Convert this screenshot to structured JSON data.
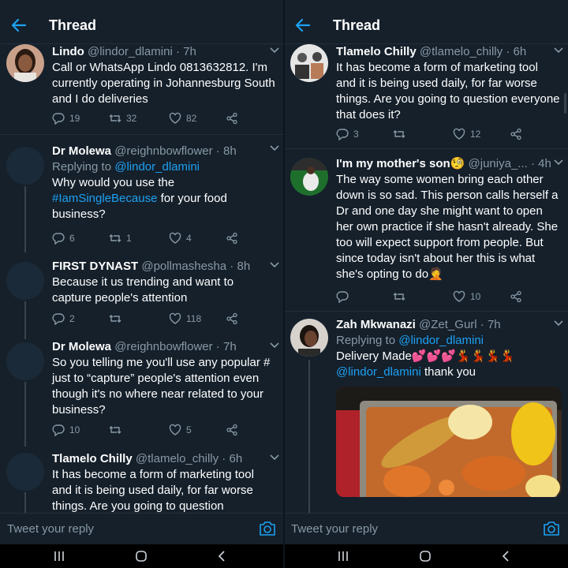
{
  "left": {
    "header": {
      "title": "Thread"
    },
    "tweets": [
      {
        "name": "Lindo",
        "handle": "@lindor_dlamini",
        "time": "7h",
        "text": "Call or WhatsApp Lindo 0813632812. I'm currently operating in Johannesburg South and I do deliveries",
        "replies": "19",
        "retweets": "32",
        "likes": "82"
      },
      {
        "name": "Dr Molewa",
        "handle": "@reighnbowflower",
        "time": "8h",
        "replying_prefix": "Replying to",
        "replying_to": "@lindor_dlamini",
        "text_before": "Why would you use the",
        "hashtag": "#IamSingleBecause",
        "text_after": "for your food business?",
        "replies": "6",
        "retweets": "1",
        "likes": "4"
      },
      {
        "name": "FIRST DYNAST",
        "handle": "@pollmashesha",
        "time": "8h",
        "text": "Because it us trending and want to capture people's attention",
        "replies": "2",
        "retweets": "",
        "likes": "118"
      },
      {
        "name": "Dr Molewa",
        "handle": "@reighnbowflower",
        "time": "7h",
        "text": "So you telling me you'll use any popular # just to “capture” people's attention even though it's no where near related to your business?",
        "replies": "10",
        "retweets": "",
        "likes": "5"
      },
      {
        "name": "Tlamelo Chilly",
        "handle": "@tlamelo_chilly",
        "time": "6h",
        "text": "It has become a form of marketing tool and it is being used daily, for far worse things. Are you going to question"
      }
    ],
    "reply_placeholder": "Tweet your reply"
  },
  "right": {
    "header": {
      "title": "Thread"
    },
    "tweets": [
      {
        "name": "Tlamelo Chilly",
        "handle": "@tlamelo_chilly",
        "time": "6h",
        "text": "It has become a form of marketing tool and it is being used daily, for far worse things. Are you going to question everyone that does it?",
        "replies": "3",
        "retweets": "",
        "likes": "12"
      },
      {
        "name": "I'm my mother's son🧐",
        "handle": "@juniya_...",
        "time": "4h",
        "text": "The way some women bring each other down is so sad. This person calls herself a Dr and one day she might want to open her own practice if she hasn't already. She too will expect support from people. But since today isn't about her this is what she's opting to do🤦",
        "replies": "",
        "retweets": "",
        "likes": "10"
      },
      {
        "name": "Zah Mkwanazi",
        "handle": "@Zet_Gurl",
        "time": "7h",
        "replying_prefix": "Replying to",
        "replying_to": "@lindor_dlamini",
        "text_before": "Delivery Made💕💕💕💃💃💃💃",
        "mention": "@lindor_dlamini",
        "text_after": "thank you"
      }
    ],
    "reply_placeholder": "Tweet your reply"
  },
  "colors": {
    "background": "#15202b",
    "accent": "#1da1f2",
    "muted": "#8899a6",
    "border": "#22303c"
  },
  "icons": [
    "back-arrow-icon",
    "chevron-down-icon",
    "reply-icon",
    "retweet-icon",
    "like-icon",
    "share-icon",
    "camera-icon",
    "recents-icon",
    "home-icon",
    "back-nav-icon"
  ]
}
